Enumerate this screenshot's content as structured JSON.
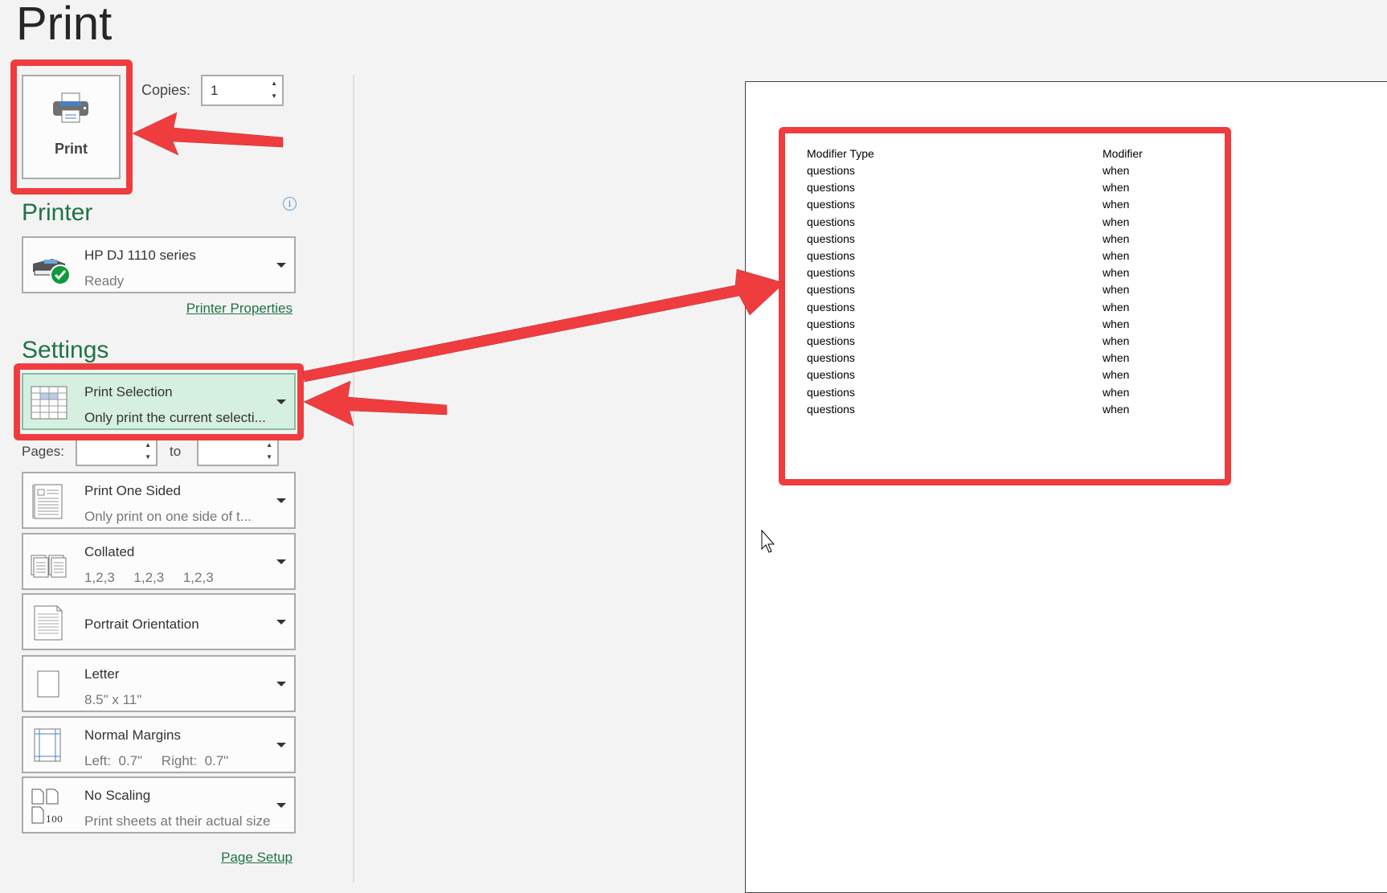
{
  "title": "Print",
  "print_button": {
    "label": "Print"
  },
  "copies": {
    "label": "Copies:",
    "value": "1"
  },
  "printer": {
    "heading": "Printer",
    "name": "HP DJ 1110 series",
    "status": "Ready",
    "properties_link": "Printer Properties"
  },
  "settings": {
    "heading": "Settings",
    "items": [
      {
        "title": "Print Selection",
        "subtitle": "Only print the current selecti..."
      },
      {
        "title": "Print One Sided",
        "subtitle": "Only print on one side of t..."
      },
      {
        "title": "Collated",
        "subtitle": "1,2,3     1,2,3     1,2,3"
      },
      {
        "title": "Portrait Orientation",
        "subtitle": ""
      },
      {
        "title": "Letter",
        "subtitle": "8.5\" x 11\""
      },
      {
        "title": "Normal Margins",
        "subtitle": "Left:  0.7\"     Right:  0.7\""
      },
      {
        "title": "No Scaling",
        "subtitle": "Print sheets at their actual size"
      }
    ],
    "pages_label": "Pages:",
    "to_label": "to",
    "scaling_icon_text": "100",
    "page_setup_link": "Page Setup"
  },
  "preview": {
    "headers": [
      "Modifier Type",
      "Modifier"
    ],
    "rows": [
      [
        "questions",
        "when"
      ],
      [
        "questions",
        "when"
      ],
      [
        "questions",
        "when"
      ],
      [
        "questions",
        "when"
      ],
      [
        "questions",
        "when"
      ],
      [
        "questions",
        "when"
      ],
      [
        "questions",
        "when"
      ],
      [
        "questions",
        "when"
      ],
      [
        "questions",
        "when"
      ],
      [
        "questions",
        "when"
      ],
      [
        "questions",
        "when"
      ],
      [
        "questions",
        "when"
      ],
      [
        "questions",
        "when"
      ],
      [
        "questions",
        "when"
      ],
      [
        "questions",
        "when"
      ]
    ]
  },
  "colors": {
    "accent": "#217346",
    "annotation": "#ef3d3f",
    "selected_bg": "#d5efe0"
  }
}
